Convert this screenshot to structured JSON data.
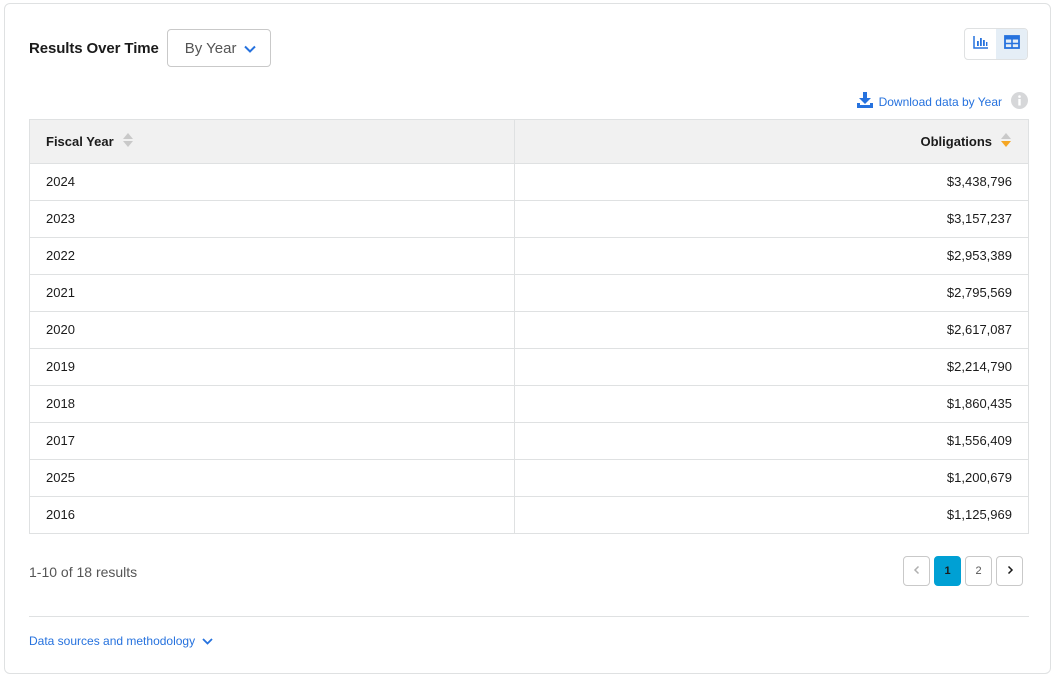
{
  "section": {
    "title": "Results Over Time",
    "period_select": {
      "value": "By Year"
    }
  },
  "view_toggle": {
    "chart_icon": "bar-chart-icon",
    "table_icon": "table-icon",
    "active": "table"
  },
  "download": {
    "label": "Download data by Year",
    "icon": "download-icon",
    "info_icon": "info-icon"
  },
  "table": {
    "columns": [
      "Fiscal Year",
      "Obligations"
    ],
    "sorted_column": "Obligations",
    "sort_direction": "desc",
    "rows": [
      {
        "year": "2024",
        "obligations": "$3,438,796"
      },
      {
        "year": "2023",
        "obligations": "$3,157,237"
      },
      {
        "year": "2022",
        "obligations": "$2,953,389"
      },
      {
        "year": "2021",
        "obligations": "$2,795,569"
      },
      {
        "year": "2020",
        "obligations": "$2,617,087"
      },
      {
        "year": "2019",
        "obligations": "$2,214,790"
      },
      {
        "year": "2018",
        "obligations": "$1,860,435"
      },
      {
        "year": "2017",
        "obligations": "$1,556,409"
      },
      {
        "year": "2025",
        "obligations": "$1,200,679"
      },
      {
        "year": "2016",
        "obligations": "$1,125,969"
      }
    ]
  },
  "pagination": {
    "summary": "1-10 of 18 results",
    "pages": [
      "1",
      "2"
    ],
    "current_page": "1"
  },
  "footer": {
    "methodology_label": "Data sources and methodology"
  },
  "colors": {
    "accent": "#2672de",
    "current_page": "#00a0d4",
    "sort_active": "#f5a623",
    "sort_inactive": "#c9c9c9",
    "header_bg": "#f1f1f1",
    "border": "#dfe1e2"
  }
}
